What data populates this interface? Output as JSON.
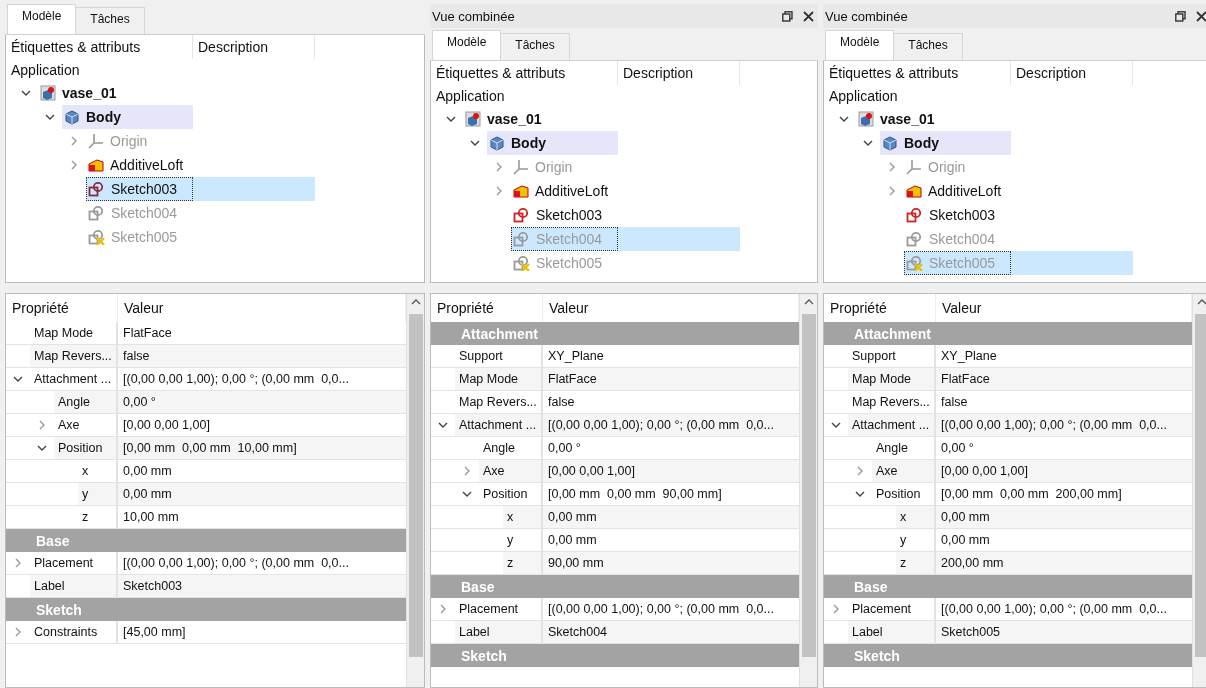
{
  "panels": [
    {
      "tabs": [
        {
          "label": "Modèle",
          "selected": true
        },
        {
          "label": "Tâches",
          "selected": false
        }
      ],
      "tree": {
        "columns": [
          "Étiquettes & attributs",
          "Description"
        ],
        "root": "Application",
        "items": [
          {
            "label": "vase_01",
            "kind": "document",
            "bold": true,
            "expanded": true,
            "children": [
              {
                "label": "Body",
                "kind": "body",
                "bold": true,
                "active": true,
                "expanded": true,
                "children": [
                  {
                    "label": "Origin",
                    "kind": "origin",
                    "hidden": true,
                    "expanded": false
                  },
                  {
                    "label": "AdditiveLoft",
                    "kind": "loft",
                    "expanded": false
                  },
                  {
                    "label": "Sketch003",
                    "kind": "sketch",
                    "selected": true
                  },
                  {
                    "label": "Sketch004",
                    "kind": "sketch",
                    "hidden": true
                  },
                  {
                    "label": "Sketch005",
                    "kind": "sketch",
                    "hidden": true,
                    "warning": true
                  }
                ]
              }
            ]
          }
        ]
      },
      "properties": {
        "columns": [
          "Propriété",
          "Valeur"
        ],
        "rows": [
          {
            "kind": "property",
            "name": "Map Mode",
            "value": "FlatFace"
          },
          {
            "kind": "property",
            "name": "Map Revers...",
            "value": "false"
          },
          {
            "kind": "property",
            "name": "Attachment ...",
            "value": "[(0,00 0,00 1,00); 0,00 °; (0,00 mm  0,0...",
            "expanded": true,
            "children": [
              {
                "kind": "property",
                "name": "Angle",
                "value": "0,00 °"
              },
              {
                "kind": "property",
                "name": "Axe",
                "value": "[0,00 0,00 1,00]",
                "expanded": false
              },
              {
                "kind": "property",
                "name": "Position",
                "value": "[0,00 mm  0,00 mm  10,00 mm]",
                "expanded": true,
                "children": [
                  {
                    "kind": "property",
                    "name": "x",
                    "value": "0,00 mm"
                  },
                  {
                    "kind": "property",
                    "name": "y",
                    "value": "0,00 mm"
                  },
                  {
                    "kind": "property",
                    "name": "z",
                    "value": "10,00 mm"
                  }
                ]
              }
            ]
          },
          {
            "kind": "group",
            "name": "Base"
          },
          {
            "kind": "property",
            "name": "Placement",
            "value": "[(0,00 0,00 1,00); 0,00 °; (0,00 mm  0,0...",
            "expanded": false
          },
          {
            "kind": "property",
            "name": "Label",
            "value": "Sketch003"
          },
          {
            "kind": "group",
            "name": "Sketch"
          },
          {
            "kind": "property",
            "name": "Constraints",
            "value": "[45,00 mm]",
            "expanded": false
          }
        ]
      }
    },
    {
      "title": "Vue combinée",
      "tabs": [
        {
          "label": "Modèle",
          "selected": true
        },
        {
          "label": "Tâches",
          "selected": false
        }
      ],
      "tree": {
        "columns": [
          "Étiquettes & attributs",
          "Description"
        ],
        "root": "Application",
        "items": [
          {
            "label": "vase_01",
            "kind": "document",
            "bold": true,
            "expanded": true,
            "children": [
              {
                "label": "Body",
                "kind": "body",
                "bold": true,
                "active": true,
                "expanded": true,
                "children": [
                  {
                    "label": "Origin",
                    "kind": "origin",
                    "hidden": true,
                    "expanded": false
                  },
                  {
                    "label": "AdditiveLoft",
                    "kind": "loft",
                    "expanded": false
                  },
                  {
                    "label": "Sketch003",
                    "kind": "sketch"
                  },
                  {
                    "label": "Sketch004",
                    "kind": "sketch",
                    "hidden": true,
                    "selected": true
                  },
                  {
                    "label": "Sketch005",
                    "kind": "sketch",
                    "hidden": true,
                    "warning": true
                  }
                ]
              }
            ]
          }
        ]
      },
      "properties": {
        "columns": [
          "Propriété",
          "Valeur"
        ],
        "rows": [
          {
            "kind": "group",
            "name": "Attachment"
          },
          {
            "kind": "property",
            "name": "Support",
            "value": "XY_Plane"
          },
          {
            "kind": "property",
            "name": "Map Mode",
            "value": "FlatFace"
          },
          {
            "kind": "property",
            "name": "Map Revers...",
            "value": "false"
          },
          {
            "kind": "property",
            "name": "Attachment ...",
            "value": "[(0,00 0,00 1,00); 0,00 °; (0,00 mm  0,0...",
            "expanded": true,
            "children": [
              {
                "kind": "property",
                "name": "Angle",
                "value": "0,00 °"
              },
              {
                "kind": "property",
                "name": "Axe",
                "value": "[0,00 0,00 1,00]",
                "expanded": false
              },
              {
                "kind": "property",
                "name": "Position",
                "value": "[0,00 mm  0,00 mm  90,00 mm]",
                "expanded": true,
                "children": [
                  {
                    "kind": "property",
                    "name": "x",
                    "value": "0,00 mm"
                  },
                  {
                    "kind": "property",
                    "name": "y",
                    "value": "0,00 mm"
                  },
                  {
                    "kind": "property",
                    "name": "z",
                    "value": "90,00 mm"
                  }
                ]
              }
            ]
          },
          {
            "kind": "group",
            "name": "Base"
          },
          {
            "kind": "property",
            "name": "Placement",
            "value": "[(0,00 0,00 1,00); 0,00 °; (0,00 mm  0,0...",
            "expanded": false
          },
          {
            "kind": "property",
            "name": "Label",
            "value": "Sketch004"
          },
          {
            "kind": "group",
            "name": "Sketch"
          }
        ]
      }
    },
    {
      "title": "Vue combinée",
      "tabs": [
        {
          "label": "Modèle",
          "selected": true
        },
        {
          "label": "Tâches",
          "selected": false
        }
      ],
      "tree": {
        "columns": [
          "Étiquettes & attributs",
          "Description"
        ],
        "root": "Application",
        "items": [
          {
            "label": "vase_01",
            "kind": "document",
            "bold": true,
            "expanded": true,
            "children": [
              {
                "label": "Body",
                "kind": "body",
                "bold": true,
                "active": true,
                "expanded": true,
                "children": [
                  {
                    "label": "Origin",
                    "kind": "origin",
                    "hidden": true,
                    "expanded": false
                  },
                  {
                    "label": "AdditiveLoft",
                    "kind": "loft",
                    "expanded": false
                  },
                  {
                    "label": "Sketch003",
                    "kind": "sketch"
                  },
                  {
                    "label": "Sketch004",
                    "kind": "sketch",
                    "hidden": true
                  },
                  {
                    "label": "Sketch005",
                    "kind": "sketch",
                    "hidden": true,
                    "warning": true,
                    "selected": true
                  }
                ]
              }
            ]
          }
        ]
      },
      "properties": {
        "columns": [
          "Propriété",
          "Valeur"
        ],
        "rows": [
          {
            "kind": "group",
            "name": "Attachment"
          },
          {
            "kind": "property",
            "name": "Support",
            "value": "XY_Plane"
          },
          {
            "kind": "property",
            "name": "Map Mode",
            "value": "FlatFace"
          },
          {
            "kind": "property",
            "name": "Map Revers...",
            "value": "false"
          },
          {
            "kind": "property",
            "name": "Attachment ...",
            "value": "[(0,00 0,00 1,00); 0,00 °; (0,00 mm  0,0...",
            "expanded": true,
            "children": [
              {
                "kind": "property",
                "name": "Angle",
                "value": "0,00 °"
              },
              {
                "kind": "property",
                "name": "Axe",
                "value": "[0,00 0,00 1,00]",
                "expanded": false
              },
              {
                "kind": "property",
                "name": "Position",
                "value": "[0,00 mm  0,00 mm  200,00 mm]",
                "expanded": true,
                "children": [
                  {
                    "kind": "property",
                    "name": "x",
                    "value": "0,00 mm"
                  },
                  {
                    "kind": "property",
                    "name": "y",
                    "value": "0,00 mm"
                  },
                  {
                    "kind": "property",
                    "name": "z",
                    "value": "200,00 mm"
                  }
                ]
              }
            ]
          },
          {
            "kind": "group",
            "name": "Base"
          },
          {
            "kind": "property",
            "name": "Placement",
            "value": "[(0,00 0,00 1,00); 0,00 °; (0,00 mm  0,0...",
            "expanded": false
          },
          {
            "kind": "property",
            "name": "Label",
            "value": "Sketch005"
          },
          {
            "kind": "group",
            "name": "Sketch"
          }
        ]
      }
    }
  ]
}
